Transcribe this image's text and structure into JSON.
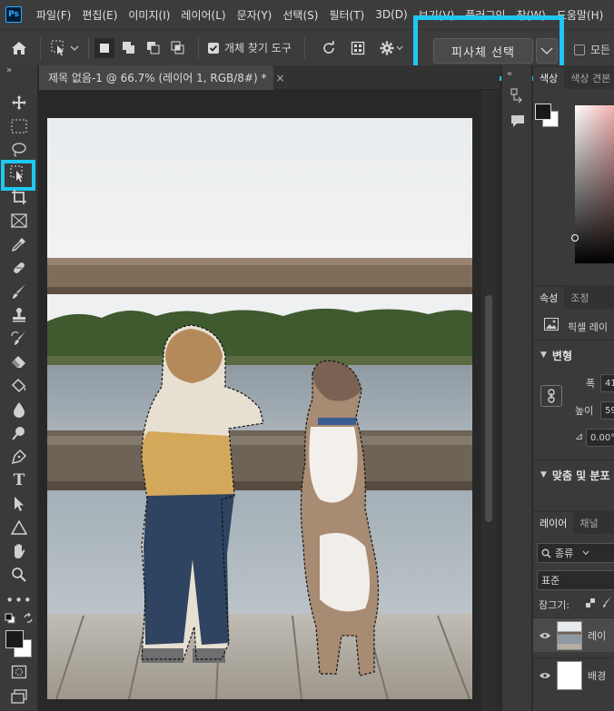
{
  "app": {
    "logo": "Ps"
  },
  "menu": [
    "파일(F)",
    "편집(E)",
    "이미지(I)",
    "레이어(L)",
    "문자(Y)",
    "선택(S)",
    "필터(T)",
    "3D(D)",
    "보기(V)",
    "플러그인",
    "창(W)",
    "도움말(H)"
  ],
  "options": {
    "object_finder_label": "개체 찾기 도구",
    "subject_select_label": "피사체 선택",
    "all_layers_label": "모든"
  },
  "document": {
    "tab_title": "제목 없음-1 @ 66.7% (레이어 1, RGB/8#) *",
    "close_glyph": "×"
  },
  "panels": {
    "color_tabs": [
      "색상",
      "색상 견본"
    ],
    "properties_tabs": [
      "속성",
      "조정"
    ],
    "pixel_layer_label": "픽셀 레이",
    "transform_header": "변형",
    "width_label": "폭",
    "width_value": "41",
    "height_label": "높이",
    "height_value": "59",
    "angle_value": "0.00°",
    "align_header": "맞춤 및 분포",
    "layers_tabs": [
      "레이어",
      "채널"
    ],
    "kind_filter": "종류",
    "blend_mode": "표준",
    "lock_label": "잠그기:",
    "layers": [
      {
        "name": "레이"
      },
      {
        "name": "배경"
      }
    ]
  },
  "colors": {
    "accent_highlight": "#1ec8f0",
    "foreground": "#1a1a1a",
    "background": "#ffffff"
  }
}
